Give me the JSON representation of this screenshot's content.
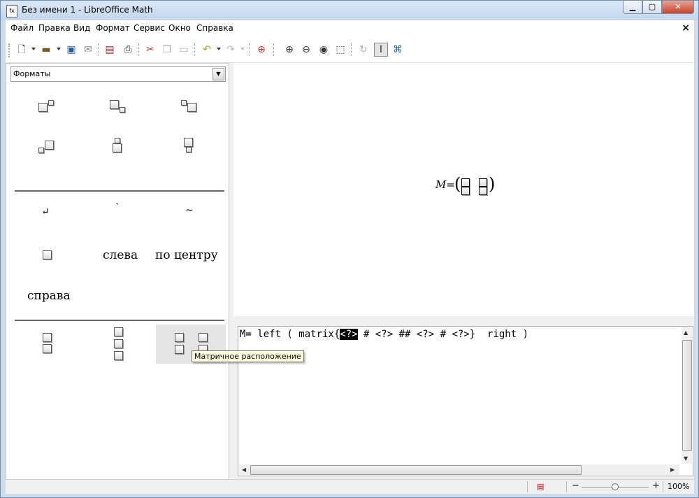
{
  "window": {
    "title": "Без имени 1 - LibreOffice Math",
    "app_icon": "fx",
    "controls": [
      "minimize-icon",
      "maximize-icon",
      "close-icon"
    ]
  },
  "menu": [
    {
      "label": "Файл"
    },
    {
      "label": "Правка"
    },
    {
      "label": "Вид"
    },
    {
      "label": "Формат"
    },
    {
      "label": "Сервис"
    },
    {
      "label": "Окно"
    },
    {
      "label": "Справка"
    }
  ],
  "document_close": "×",
  "toolbar_icons": [
    "new-icon",
    "open-icon",
    "save-icon",
    "email-icon",
    "export-pdf-icon",
    "print-icon",
    "cut-icon",
    "copy-icon",
    "paste-icon",
    "undo-icon",
    "redo-icon",
    "help-icon",
    "zoom-in-icon",
    "zoom-out-icon",
    "zoom-100-icon",
    "show-all-icon",
    "update-icon",
    "formula-cursor-icon",
    "symbols-icon"
  ],
  "elements_panel": {
    "category": "Форматы",
    "labels": {
      "left": "слева",
      "center": "по центру",
      "right": "справа"
    }
  },
  "preview": {
    "formula_lhs": "M",
    "formula_eq": "="
  },
  "editor": {
    "text_before": "M= left ( matrix{",
    "selected": "<?>",
    "text_after": " # <?> ## <?> # <?>}  right )"
  },
  "tooltip": "Матричное расположение",
  "status": {
    "zoom": "100%",
    "zoom_fraction": 0.5
  },
  "colors": {
    "titlebar": "#c3d6ec",
    "close_button": "#c7432b",
    "tooltip_bg": "#ffffe1",
    "selection": "#000000"
  }
}
